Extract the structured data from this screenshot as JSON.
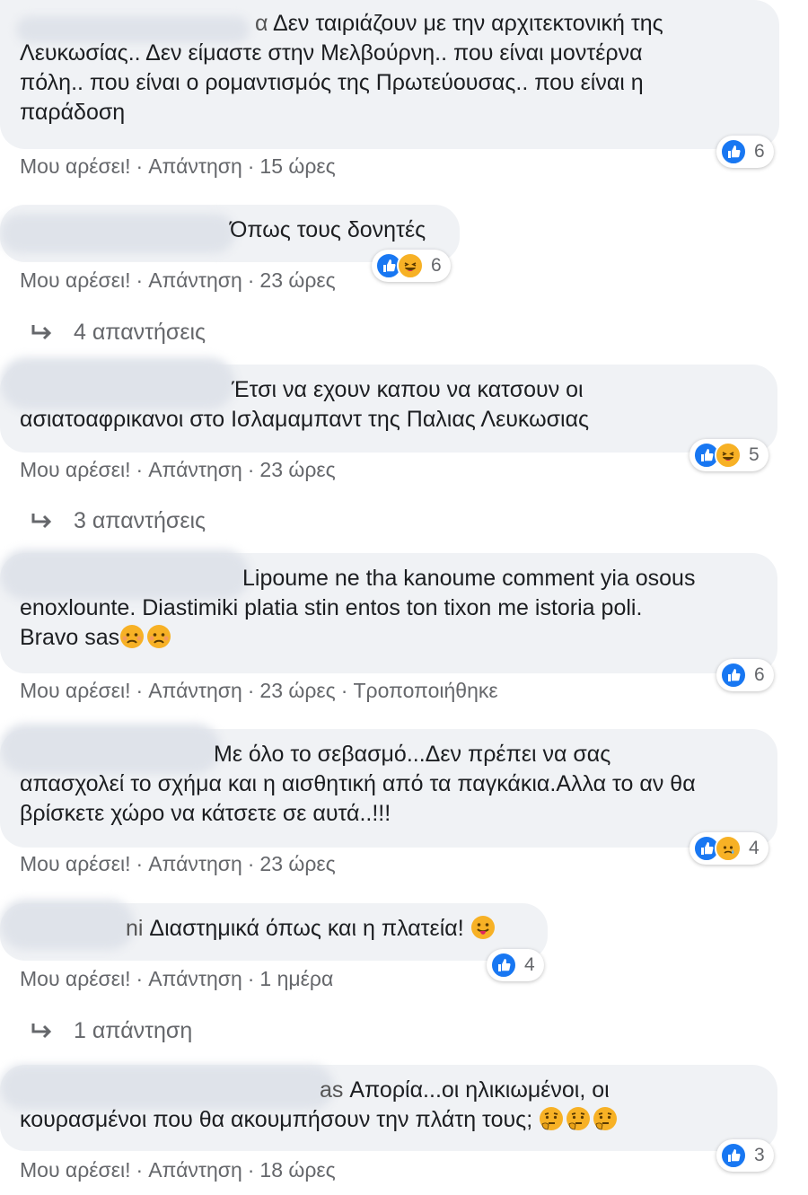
{
  "comments": [
    {
      "text": "Δεν ταιριάζουν με την αρχιτεκτονική της Λευκωσίας.. Δεν είμαστε στην Μελβούρνη.. που είναι μοντέρνα πόλη.. που είναι ο ρομαντισμός της Πρωτεύουσας.. που είναι η παράδοση",
      "line1": "Δεν ταιριάζουν με την αρχιτεκτονική της",
      "line2": "Λευκωσίας.. Δεν είμαστε στην Μελβούρνη.. που είναι μοντέρνα",
      "line3": "πόλη.. που είναι ο ρομαντισμός της Πρωτεύουσας.. που είναι η",
      "line4": "παράδοση",
      "time": "15 ώρες",
      "reactions": [
        "like"
      ],
      "reaction_count": "6"
    },
    {
      "line1": "Όπως τους δονητές",
      "time": "23 ώρες",
      "reactions": [
        "like",
        "haha"
      ],
      "reaction_count": "6",
      "replies_label": "4 απαντήσεις"
    },
    {
      "line1": "Έτσι να εχουν καπου να κατσουν οι",
      "line2": "ασιατοαφρικανοι στο Ισλαμαμπαντ της Παλιας Λευκωσιας",
      "time": "23 ώρες",
      "reactions": [
        "like",
        "haha"
      ],
      "reaction_count": "5",
      "replies_label": "3 απαντήσεις"
    },
    {
      "line1": "Lipoume ne tha kanoume comment yia osous",
      "line2": "enoxlounte. Diastimiki platia stin entos ton tixon me istoria poli.",
      "line3": "Bravo sas",
      "time": "23 ώρες",
      "edited": "Τροποποιήθηκε",
      "reactions": [
        "like"
      ],
      "reaction_count": "6"
    },
    {
      "line1": "Με όλο το σεβασμό...Δεν πρέπει να σας",
      "line2": "απασχολεί το σχήμα και η αισθητική από τα παγκάκια.Αλλα το αν θα",
      "line3": "βρίσκετε χώρο να κάτσετε σε αυτά..!!!",
      "time": "23 ώρες",
      "reactions": [
        "like",
        "sad"
      ],
      "reaction_count": "4"
    },
    {
      "line1": "Διαστημικά όπως και η πλατεία!",
      "time": "1 ημέρα",
      "reactions": [
        "like"
      ],
      "reaction_count": "4",
      "replies_label": "1 απάντηση"
    },
    {
      "line1": "Απορία...οι ηλικιωμένοι, οι",
      "line2": "κουρασμένοι που θα ακουμπήσουν την πλάτη τους;",
      "time": "18 ώρες",
      "reactions": [
        "like"
      ],
      "reaction_count": "3"
    }
  ],
  "actions": {
    "like": "Μου αρέσει!",
    "reply": "Απάντηση",
    "dot": "·"
  },
  "colors": {
    "bubble": "#f0f2f5",
    "meta_text": "#65676b",
    "like_blue": "#1877f2",
    "emoji_yellow": "#f7b125"
  },
  "fragments": {
    "c1_name_tail": "α",
    "c6_name_tail": "ni",
    "c7_name_tail": "as"
  }
}
